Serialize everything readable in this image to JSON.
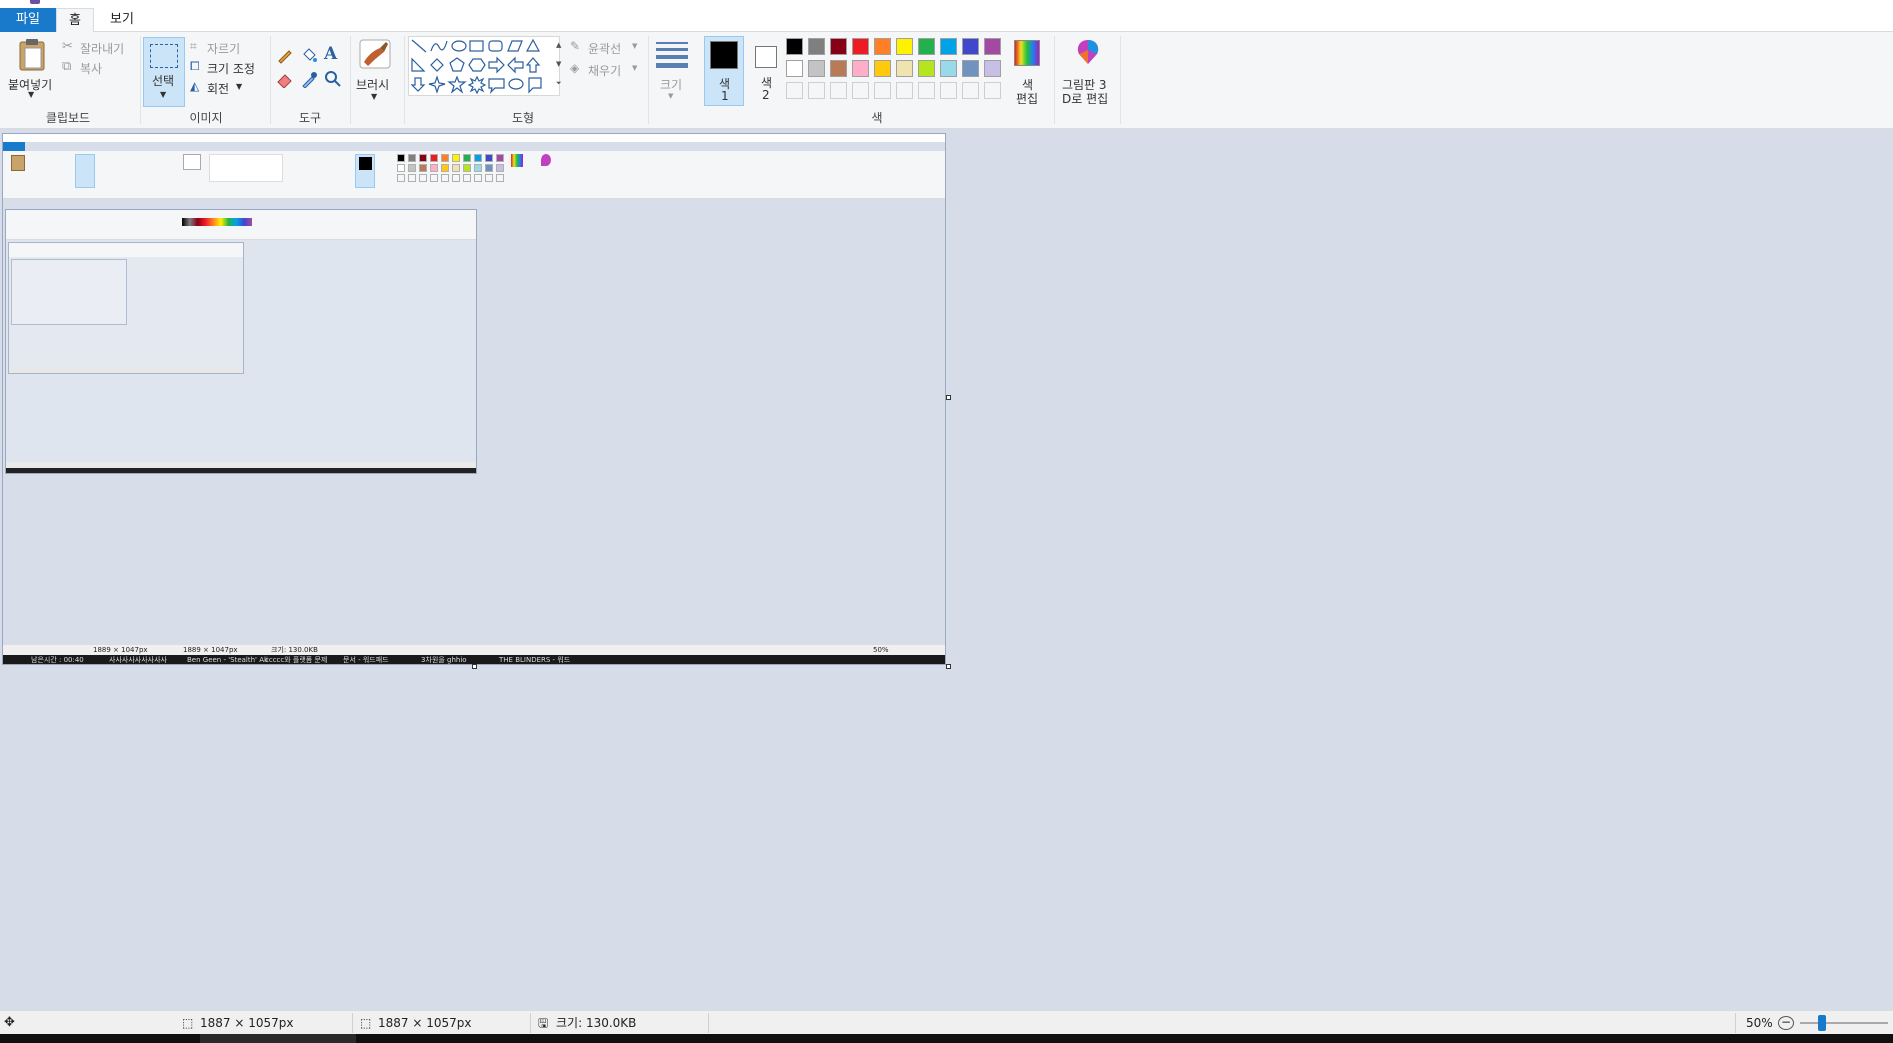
{
  "menubar": {
    "file_tab": "파일",
    "home_tab": "홈",
    "view_tab": "보기"
  },
  "ribbon": {
    "clipboard": {
      "paste": "붙여넣기",
      "cut": "잘라내기",
      "copy": "복사",
      "group_label": "클립보드"
    },
    "image": {
      "select": "선택",
      "crop": "자르기",
      "resize": "크기 조정",
      "rotate": "회전",
      "group_label": "이미지"
    },
    "tools": {
      "group_label": "도구"
    },
    "brushes": {
      "label": "브러시"
    },
    "shapes": {
      "outline": "윤곽선",
      "fill": "채우기",
      "group_label": "도형"
    },
    "size": {
      "label": "크기"
    },
    "colors": {
      "color1_label": "색",
      "color1_num": "1",
      "color2_label": "색",
      "color2_num": "2",
      "edit_colors_line1": "색",
      "edit_colors_line2": "편집",
      "group_label": "색",
      "palette_row1": [
        "#000000",
        "#7f7f7f",
        "#880015",
        "#ed1c24",
        "#ff7f27",
        "#fff200",
        "#22b14c",
        "#00a2e8",
        "#3f48cc",
        "#a349a4"
      ],
      "palette_row2": [
        "#ffffff",
        "#c3c3c3",
        "#b97a57",
        "#ffaec9",
        "#ffc90e",
        "#efe4b0",
        "#b5e61d",
        "#99d9ea",
        "#7092be",
        "#c8bfe7"
      ],
      "color1_value": "#000000",
      "color2_value": "#ffffff"
    },
    "paint3d": {
      "line1": "그림판 3",
      "line2": "D로 편집"
    }
  },
  "statusbar": {
    "selection_size": "1887 × 1057px",
    "image_size": "1887 × 1057px",
    "file_size": "크기: 130.0KB",
    "zoom": "50%"
  },
  "embedded": {
    "status_selection": "1889 × 1047px",
    "status_image": "1889 × 1047px",
    "status_filesize": "크기: 130.0KB",
    "status_zoom": "50%",
    "taskbar_items": [
      "남은시간 : 00:40",
      "사사사사사사사사사",
      "Ben Geen - 'Stealth' Ali",
      "ccccc와 플랫폼 문제",
      "문서 - 워드패드",
      "3차원을 ghhio",
      "THE BLINDERS - 워드"
    ]
  },
  "accent_color": "#1979ca"
}
